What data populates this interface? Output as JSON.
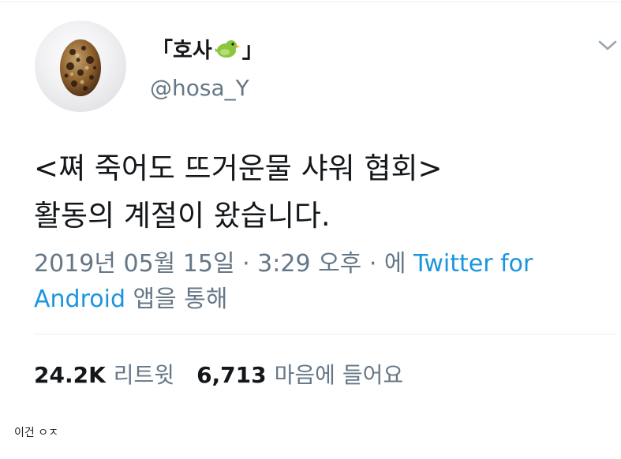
{
  "profile": {
    "display_name_prefix": "「호사",
    "display_name_suffix": "」",
    "display_name_emoji": "bird-icon",
    "handle": "@hosa_Y"
  },
  "tweet": {
    "line1": "<쪄 죽어도 뜨거운물 샤워 협회>",
    "line2": "활동의 계절이 왔습니다."
  },
  "meta": {
    "datetime": "2019년 05월 15일 · 3:29 오후 · 에 ",
    "source_link_part1": "Twitter for",
    "source_link_part2": "Android",
    "source_suffix": " 앱을 통해"
  },
  "stats": {
    "retweets_count": "24.2K",
    "retweets_label": "리트윗",
    "likes_count": "6,713",
    "likes_label": "마음에 들어요"
  },
  "caption": "이건 ㅇㅈ",
  "colors": {
    "link": "#1b95e0",
    "muted": "#657786",
    "text": "#14171a",
    "divider": "#e6ecf0"
  },
  "icons": {
    "avatar": "egg-avatar",
    "menu": "chevron-down-icon"
  }
}
